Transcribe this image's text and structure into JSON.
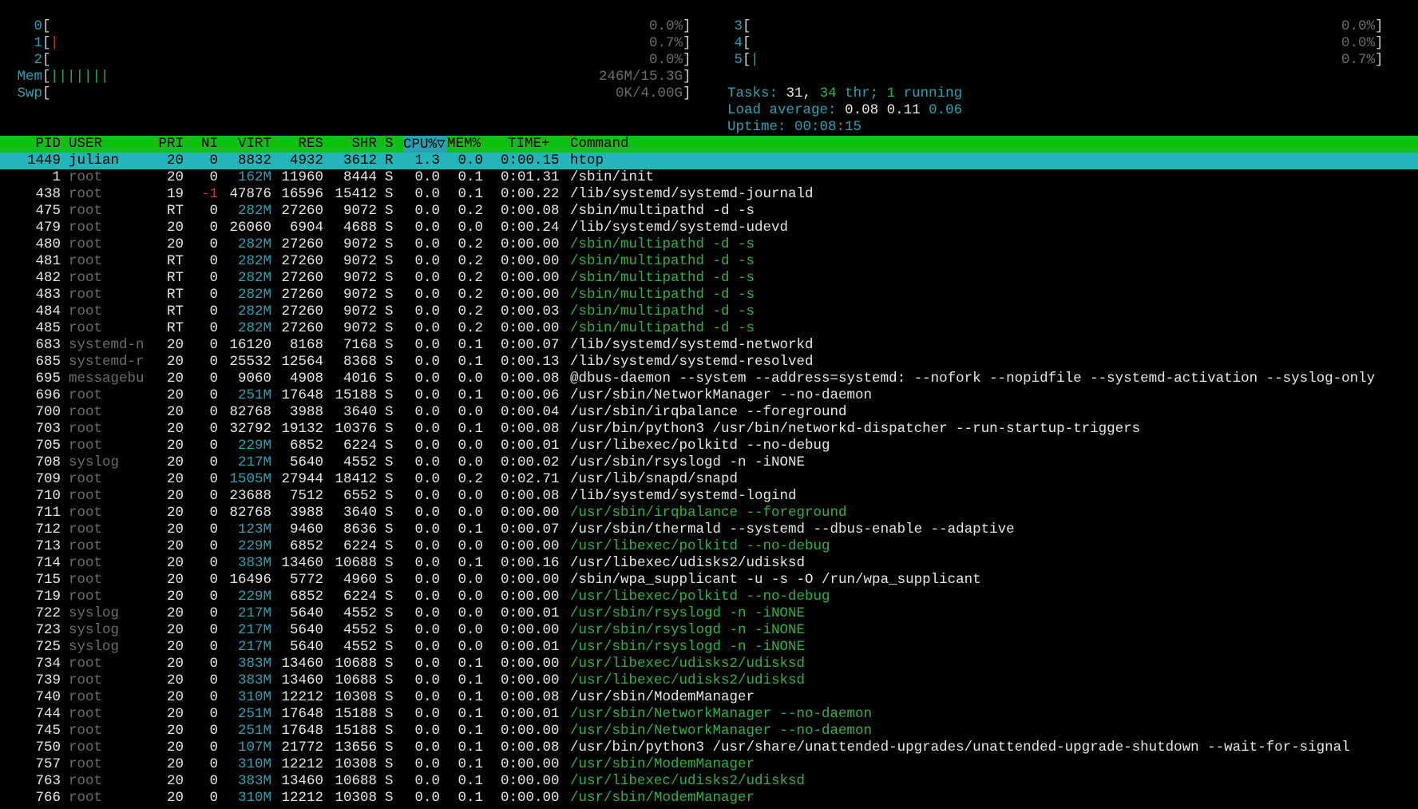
{
  "meters": {
    "left": [
      {
        "label": "0",
        "bar": "",
        "bar_color": "green",
        "value": "0.0%"
      },
      {
        "label": "1",
        "bar": "|",
        "bar_color": "red",
        "value": "0.7%"
      },
      {
        "label": "2",
        "bar": "",
        "bar_color": "green",
        "value": "0.0%"
      },
      {
        "label": "Mem",
        "bar": "|||||||",
        "bar_color": "green",
        "value": "246M/15.3G"
      },
      {
        "label": "Swp",
        "bar": "",
        "bar_color": "green",
        "value": "0K/4.00G"
      }
    ],
    "right": [
      {
        "label": "3",
        "bar": "",
        "bar_color": "green",
        "value": "0.0%"
      },
      {
        "label": "4",
        "bar": "",
        "bar_color": "green",
        "value": "0.0%"
      },
      {
        "label": "5",
        "bar": "|",
        "bar_color": "green",
        "value": "0.7%"
      }
    ]
  },
  "tasks": {
    "label": "Tasks:",
    "total": "31,",
    "threads": "34",
    "thr_label": "thr;",
    "running": "1",
    "running_label": "running"
  },
  "load": {
    "label": "Load average:",
    "one": "0.08",
    "five": "0.11",
    "fifteen": "0.06"
  },
  "uptime": {
    "label": "Uptime:",
    "value": "00:08:15"
  },
  "columns": {
    "pid": "PID",
    "user": "USER",
    "pri": "PRI",
    "ni": "NI",
    "virt": "VIRT",
    "res": "RES",
    "shr": "SHR",
    "s": "S",
    "cpu": "CPU%▽",
    "mem": "MEM%",
    "time": "TIME+",
    "command": "Command"
  },
  "colors": {
    "header_bg": "#0fbf12",
    "selected_bg": "#23b5b9",
    "label_cyan": "#2aa1b3",
    "thread_green": "#2db343"
  },
  "processes": [
    {
      "pid": "1449",
      "user": "julian",
      "pri": "20",
      "ni": "0",
      "virt": "8832",
      "res": "4932",
      "shr": "3612",
      "s": "R",
      "cpu": "1.3",
      "mem": "0.0",
      "time": "0:00.15",
      "command": "htop",
      "selected": true
    },
    {
      "pid": "1",
      "user": "root",
      "pri": "20",
      "ni": "0",
      "virt": "162M",
      "res": "11960",
      "shr": "8444",
      "s": "S",
      "cpu": "0.0",
      "mem": "0.1",
      "time": "0:01.31",
      "command": "/sbin/init"
    },
    {
      "pid": "438",
      "user": "root",
      "pri": "19",
      "ni": "-1",
      "virt": "47876",
      "res": "16596",
      "shr": "15412",
      "s": "S",
      "cpu": "0.0",
      "mem": "0.1",
      "time": "0:00.22",
      "command": "/lib/systemd/systemd-journald"
    },
    {
      "pid": "475",
      "user": "root",
      "pri": "RT",
      "ni": "0",
      "virt": "282M",
      "res": "27260",
      "shr": "9072",
      "s": "S",
      "cpu": "0.0",
      "mem": "0.2",
      "time": "0:00.08",
      "command": "/sbin/multipathd -d -s"
    },
    {
      "pid": "479",
      "user": "root",
      "pri": "20",
      "ni": "0",
      "virt": "26060",
      "res": "6904",
      "shr": "4688",
      "s": "S",
      "cpu": "0.0",
      "mem": "0.0",
      "time": "0:00.24",
      "command": "/lib/systemd/systemd-udevd"
    },
    {
      "pid": "480",
      "user": "root",
      "pri": "20",
      "ni": "0",
      "virt": "282M",
      "res": "27260",
      "shr": "9072",
      "s": "S",
      "cpu": "0.0",
      "mem": "0.2",
      "time": "0:00.00",
      "command": "/sbin/multipathd -d -s",
      "thread": true
    },
    {
      "pid": "481",
      "user": "root",
      "pri": "RT",
      "ni": "0",
      "virt": "282M",
      "res": "27260",
      "shr": "9072",
      "s": "S",
      "cpu": "0.0",
      "mem": "0.2",
      "time": "0:00.00",
      "command": "/sbin/multipathd -d -s",
      "thread": true
    },
    {
      "pid": "482",
      "user": "root",
      "pri": "RT",
      "ni": "0",
      "virt": "282M",
      "res": "27260",
      "shr": "9072",
      "s": "S",
      "cpu": "0.0",
      "mem": "0.2",
      "time": "0:00.00",
      "command": "/sbin/multipathd -d -s",
      "thread": true
    },
    {
      "pid": "483",
      "user": "root",
      "pri": "RT",
      "ni": "0",
      "virt": "282M",
      "res": "27260",
      "shr": "9072",
      "s": "S",
      "cpu": "0.0",
      "mem": "0.2",
      "time": "0:00.00",
      "command": "/sbin/multipathd -d -s",
      "thread": true
    },
    {
      "pid": "484",
      "user": "root",
      "pri": "RT",
      "ni": "0",
      "virt": "282M",
      "res": "27260",
      "shr": "9072",
      "s": "S",
      "cpu": "0.0",
      "mem": "0.2",
      "time": "0:00.03",
      "command": "/sbin/multipathd -d -s",
      "thread": true
    },
    {
      "pid": "485",
      "user": "root",
      "pri": "RT",
      "ni": "0",
      "virt": "282M",
      "res": "27260",
      "shr": "9072",
      "s": "S",
      "cpu": "0.0",
      "mem": "0.2",
      "time": "0:00.00",
      "command": "/sbin/multipathd -d -s",
      "thread": true
    },
    {
      "pid": "683",
      "user": "systemd-n",
      "pri": "20",
      "ni": "0",
      "virt": "16120",
      "res": "8168",
      "shr": "7168",
      "s": "S",
      "cpu": "0.0",
      "mem": "0.1",
      "time": "0:00.07",
      "command": "/lib/systemd/systemd-networkd"
    },
    {
      "pid": "685",
      "user": "systemd-r",
      "pri": "20",
      "ni": "0",
      "virt": "25532",
      "res": "12564",
      "shr": "8368",
      "s": "S",
      "cpu": "0.0",
      "mem": "0.1",
      "time": "0:00.13",
      "command": "/lib/systemd/systemd-resolved"
    },
    {
      "pid": "695",
      "user": "messagebu",
      "pri": "20",
      "ni": "0",
      "virt": "9060",
      "res": "4908",
      "shr": "4016",
      "s": "S",
      "cpu": "0.0",
      "mem": "0.0",
      "time": "0:00.08",
      "command": "@dbus-daemon --system --address=systemd: --nofork --nopidfile --systemd-activation --syslog-only"
    },
    {
      "pid": "696",
      "user": "root",
      "pri": "20",
      "ni": "0",
      "virt": "251M",
      "res": "17648",
      "shr": "15188",
      "s": "S",
      "cpu": "0.0",
      "mem": "0.1",
      "time": "0:00.06",
      "command": "/usr/sbin/NetworkManager --no-daemon"
    },
    {
      "pid": "700",
      "user": "root",
      "pri": "20",
      "ni": "0",
      "virt": "82768",
      "res": "3988",
      "shr": "3640",
      "s": "S",
      "cpu": "0.0",
      "mem": "0.0",
      "time": "0:00.04",
      "command": "/usr/sbin/irqbalance --foreground"
    },
    {
      "pid": "703",
      "user": "root",
      "pri": "20",
      "ni": "0",
      "virt": "32792",
      "res": "19132",
      "shr": "10376",
      "s": "S",
      "cpu": "0.0",
      "mem": "0.1",
      "time": "0:00.08",
      "command": "/usr/bin/python3 /usr/bin/networkd-dispatcher --run-startup-triggers"
    },
    {
      "pid": "705",
      "user": "root",
      "pri": "20",
      "ni": "0",
      "virt": "229M",
      "res": "6852",
      "shr": "6224",
      "s": "S",
      "cpu": "0.0",
      "mem": "0.0",
      "time": "0:00.01",
      "command": "/usr/libexec/polkitd --no-debug"
    },
    {
      "pid": "708",
      "user": "syslog",
      "pri": "20",
      "ni": "0",
      "virt": "217M",
      "res": "5640",
      "shr": "4552",
      "s": "S",
      "cpu": "0.0",
      "mem": "0.0",
      "time": "0:00.02",
      "command": "/usr/sbin/rsyslogd -n -iNONE"
    },
    {
      "pid": "709",
      "user": "root",
      "pri": "20",
      "ni": "0",
      "virt": "1505M",
      "res": "27944",
      "shr": "18412",
      "s": "S",
      "cpu": "0.0",
      "mem": "0.2",
      "time": "0:02.71",
      "command": "/usr/lib/snapd/snapd"
    },
    {
      "pid": "710",
      "user": "root",
      "pri": "20",
      "ni": "0",
      "virt": "23688",
      "res": "7512",
      "shr": "6552",
      "s": "S",
      "cpu": "0.0",
      "mem": "0.0",
      "time": "0:00.08",
      "command": "/lib/systemd/systemd-logind"
    },
    {
      "pid": "711",
      "user": "root",
      "pri": "20",
      "ni": "0",
      "virt": "82768",
      "res": "3988",
      "shr": "3640",
      "s": "S",
      "cpu": "0.0",
      "mem": "0.0",
      "time": "0:00.00",
      "command": "/usr/sbin/irqbalance --foreground",
      "thread": true
    },
    {
      "pid": "712",
      "user": "root",
      "pri": "20",
      "ni": "0",
      "virt": "123M",
      "res": "9460",
      "shr": "8636",
      "s": "S",
      "cpu": "0.0",
      "mem": "0.1",
      "time": "0:00.07",
      "command": "/usr/sbin/thermald --systemd --dbus-enable --adaptive"
    },
    {
      "pid": "713",
      "user": "root",
      "pri": "20",
      "ni": "0",
      "virt": "229M",
      "res": "6852",
      "shr": "6224",
      "s": "S",
      "cpu": "0.0",
      "mem": "0.0",
      "time": "0:00.00",
      "command": "/usr/libexec/polkitd --no-debug",
      "thread": true
    },
    {
      "pid": "714",
      "user": "root",
      "pri": "20",
      "ni": "0",
      "virt": "383M",
      "res": "13460",
      "shr": "10688",
      "s": "S",
      "cpu": "0.0",
      "mem": "0.1",
      "time": "0:00.16",
      "command": "/usr/libexec/udisks2/udisksd"
    },
    {
      "pid": "715",
      "user": "root",
      "pri": "20",
      "ni": "0",
      "virt": "16496",
      "res": "5772",
      "shr": "4960",
      "s": "S",
      "cpu": "0.0",
      "mem": "0.0",
      "time": "0:00.00",
      "command": "/sbin/wpa_supplicant -u -s -O /run/wpa_supplicant"
    },
    {
      "pid": "719",
      "user": "root",
      "pri": "20",
      "ni": "0",
      "virt": "229M",
      "res": "6852",
      "shr": "6224",
      "s": "S",
      "cpu": "0.0",
      "mem": "0.0",
      "time": "0:00.00",
      "command": "/usr/libexec/polkitd --no-debug",
      "thread": true
    },
    {
      "pid": "722",
      "user": "syslog",
      "pri": "20",
      "ni": "0",
      "virt": "217M",
      "res": "5640",
      "shr": "4552",
      "s": "S",
      "cpu": "0.0",
      "mem": "0.0",
      "time": "0:00.01",
      "command": "/usr/sbin/rsyslogd -n -iNONE",
      "thread": true
    },
    {
      "pid": "723",
      "user": "syslog",
      "pri": "20",
      "ni": "0",
      "virt": "217M",
      "res": "5640",
      "shr": "4552",
      "s": "S",
      "cpu": "0.0",
      "mem": "0.0",
      "time": "0:00.00",
      "command": "/usr/sbin/rsyslogd -n -iNONE",
      "thread": true
    },
    {
      "pid": "725",
      "user": "syslog",
      "pri": "20",
      "ni": "0",
      "virt": "217M",
      "res": "5640",
      "shr": "4552",
      "s": "S",
      "cpu": "0.0",
      "mem": "0.0",
      "time": "0:00.01",
      "command": "/usr/sbin/rsyslogd -n -iNONE",
      "thread": true
    },
    {
      "pid": "734",
      "user": "root",
      "pri": "20",
      "ni": "0",
      "virt": "383M",
      "res": "13460",
      "shr": "10688",
      "s": "S",
      "cpu": "0.0",
      "mem": "0.1",
      "time": "0:00.00",
      "command": "/usr/libexec/udisks2/udisksd",
      "thread": true
    },
    {
      "pid": "739",
      "user": "root",
      "pri": "20",
      "ni": "0",
      "virt": "383M",
      "res": "13460",
      "shr": "10688",
      "s": "S",
      "cpu": "0.0",
      "mem": "0.1",
      "time": "0:00.00",
      "command": "/usr/libexec/udisks2/udisksd",
      "thread": true
    },
    {
      "pid": "740",
      "user": "root",
      "pri": "20",
      "ni": "0",
      "virt": "310M",
      "res": "12212",
      "shr": "10308",
      "s": "S",
      "cpu": "0.0",
      "mem": "0.1",
      "time": "0:00.08",
      "command": "/usr/sbin/ModemManager"
    },
    {
      "pid": "744",
      "user": "root",
      "pri": "20",
      "ni": "0",
      "virt": "251M",
      "res": "17648",
      "shr": "15188",
      "s": "S",
      "cpu": "0.0",
      "mem": "0.1",
      "time": "0:00.01",
      "command": "/usr/sbin/NetworkManager --no-daemon",
      "thread": true
    },
    {
      "pid": "745",
      "user": "root",
      "pri": "20",
      "ni": "0",
      "virt": "251M",
      "res": "17648",
      "shr": "15188",
      "s": "S",
      "cpu": "0.0",
      "mem": "0.1",
      "time": "0:00.00",
      "command": "/usr/sbin/NetworkManager --no-daemon",
      "thread": true
    },
    {
      "pid": "750",
      "user": "root",
      "pri": "20",
      "ni": "0",
      "virt": "107M",
      "res": "21772",
      "shr": "13656",
      "s": "S",
      "cpu": "0.0",
      "mem": "0.1",
      "time": "0:00.08",
      "command": "/usr/bin/python3 /usr/share/unattended-upgrades/unattended-upgrade-shutdown --wait-for-signal"
    },
    {
      "pid": "757",
      "user": "root",
      "pri": "20",
      "ni": "0",
      "virt": "310M",
      "res": "12212",
      "shr": "10308",
      "s": "S",
      "cpu": "0.0",
      "mem": "0.1",
      "time": "0:00.00",
      "command": "/usr/sbin/ModemManager",
      "thread": true
    },
    {
      "pid": "763",
      "user": "root",
      "pri": "20",
      "ni": "0",
      "virt": "383M",
      "res": "13460",
      "shr": "10688",
      "s": "S",
      "cpu": "0.0",
      "mem": "0.1",
      "time": "0:00.00",
      "command": "/usr/libexec/udisks2/udisksd",
      "thread": true
    },
    {
      "pid": "766",
      "user": "root",
      "pri": "20",
      "ni": "0",
      "virt": "310M",
      "res": "12212",
      "shr": "10308",
      "s": "S",
      "cpu": "0.0",
      "mem": "0.1",
      "time": "0:00.00",
      "command": "/usr/sbin/ModemManager",
      "thread": true
    }
  ]
}
